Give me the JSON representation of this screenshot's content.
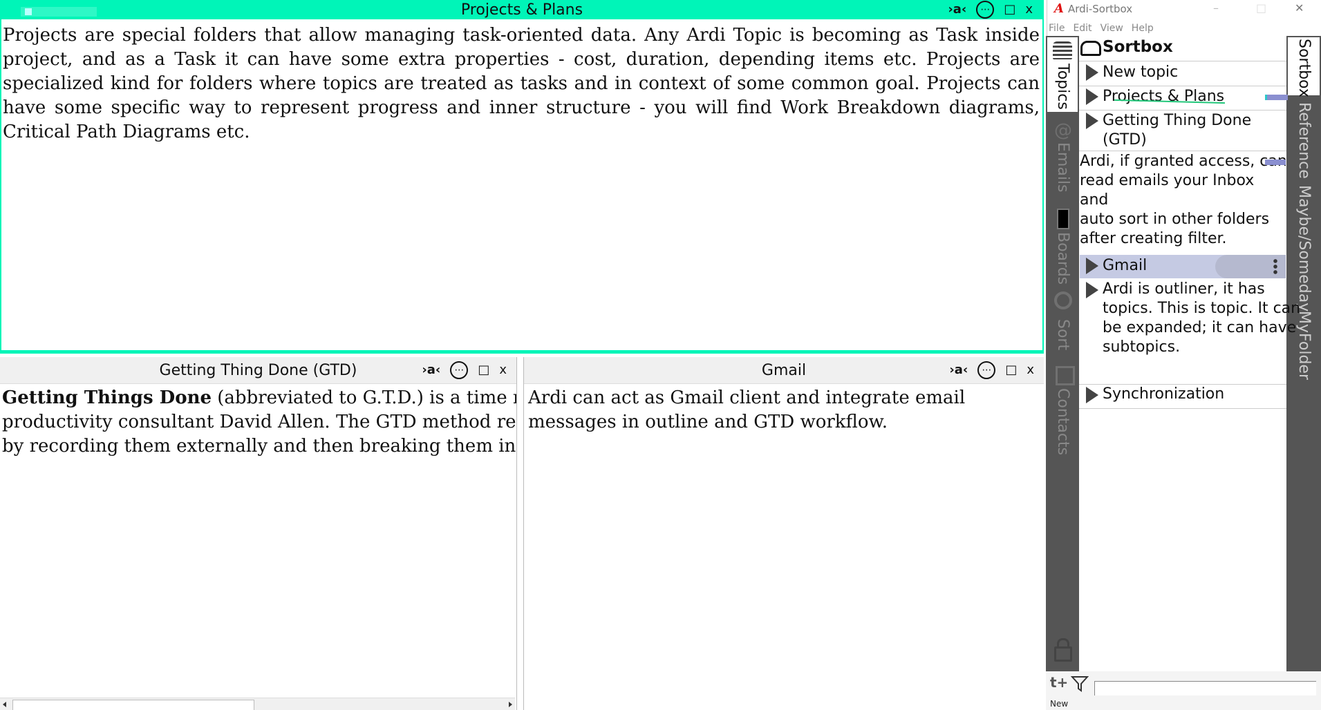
{
  "top_panel": {
    "title": "Projects & Plans",
    "body": "Projects are special folders that allow managing task-oriented data. Any Ardi Topic is becoming as Task inside project, and as a Task it can have some extra properties - cost, duration, depending items etc. Projects are specialized kind for folders where topics are treated as tasks and in context of some common goal. Projects can have some specific way to represent progress and inner structure - you will find Work Breakdown diagrams, Critical Path Diagrams etc."
  },
  "bottom_left_panel": {
    "title": "Getting Thing Done (GTD)",
    "bold_lead": "Getting Things Done",
    "line1_rest": " (abbreviated to G.T.D.) is a time manag",
    "line2": "productivity consultant David Allen. The GTD method rests or",
    "line3": "by recording them externally and then breaking them into actio"
  },
  "bottom_right_panel": {
    "title": "Gmail",
    "body": "Ardi can act as Gmail client and integrate email messages in outline and GTD workflow."
  },
  "panel_buttons": {
    "ai": "›a‹",
    "more": "⋯",
    "maximize": "□",
    "close": "x"
  },
  "sortbox_app": {
    "logo": "A",
    "window_title": "Ardi-Sortbox",
    "win_minimize": "–",
    "win_maximize": "□",
    "win_close": "✕",
    "menu": [
      "File",
      "Edit",
      "View",
      "Help"
    ],
    "left_tabs": [
      "Topics",
      "Emails",
      "Boards",
      "Sort",
      "Contacts"
    ],
    "right_tabs": [
      "Sortbox",
      "Reference",
      "Maybe/Someday",
      "MyFolder"
    ],
    "root": "Sortbox",
    "tree": {
      "new_topic": "New topic",
      "projects": "Projects & Plans",
      "gtd_line1": "Getting Thing Done",
      "gtd_line2": "(GTD)",
      "note_lines": [
        "Ardi, if granted access, can",
        "read emails your Inbox and",
        "auto sort in other folders",
        "after creating filter."
      ],
      "gmail": "Gmail",
      "outliner_lines": [
        "Ardi is outliner, it has",
        "topics. This is topic. It can",
        "be expanded; it can have",
        "subtopics."
      ],
      "sync": "Synchronization"
    },
    "bottom": {
      "new_icon": "t+",
      "new_label": "New",
      "filter_value": ""
    }
  },
  "colors": {
    "accent": "#00f5b8",
    "sidebar": "#555555",
    "selected_row": "#c5cae3",
    "tag": "#8a8fd0"
  }
}
